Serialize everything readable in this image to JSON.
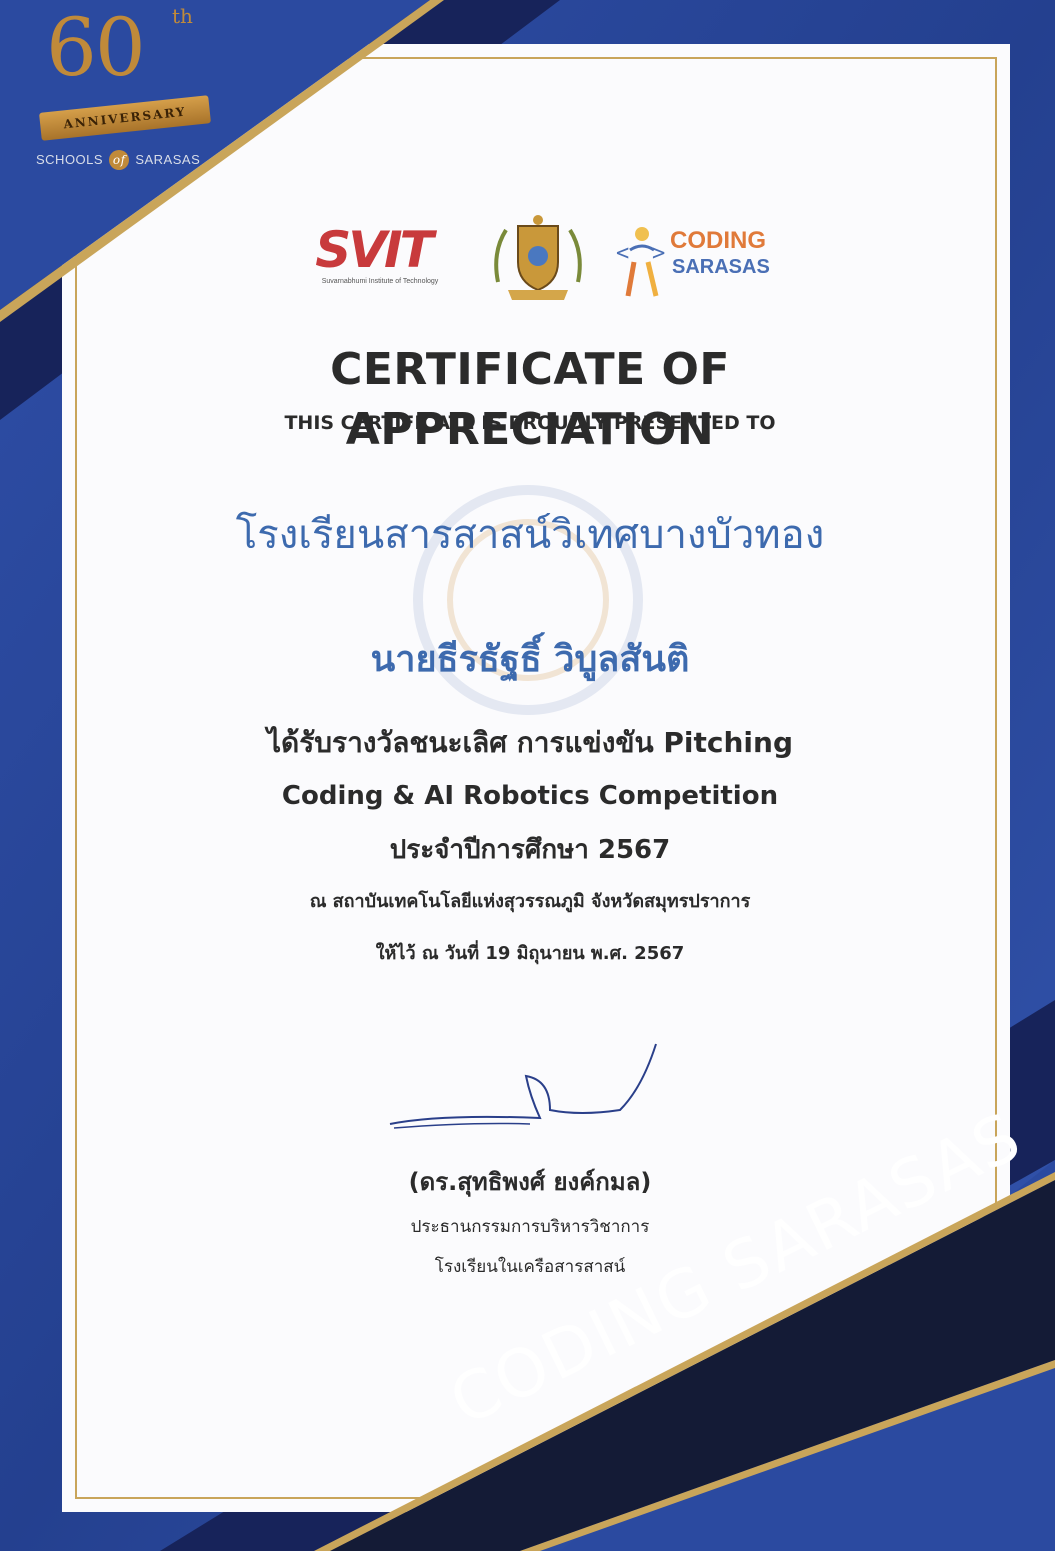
{
  "colors": {
    "frame_navy": "#1a2a6e",
    "frame_blue": "#2f4fa8",
    "gold": "#c08a3a",
    "paper": "#fbfbfd",
    "accent_blue_text": "#3d6aae",
    "body_text": "#2b2b2b",
    "ribbon_dark": "#141b36"
  },
  "anniversary_badge": {
    "number": "60",
    "ordinal": "th",
    "ribbon_text": "ANNIVERSARY",
    "schools_text_left": "SCHOOLS",
    "schools_text_of": "of",
    "schools_text_right": "SARASAS"
  },
  "logos": {
    "svit_mark": "SVIT",
    "svit_subtitle": "Suvarnabhumi Institute of Technology",
    "crest_icon": "school-crest-icon",
    "coding_word": "CODING",
    "sarasas_word": "SARASAS"
  },
  "certificate": {
    "title": "CERTIFICATE OF APPRECIATION",
    "subtitle": "THIS CERTIFICATE IS PROUDLY PRESENTED TO",
    "school": "โรงเรียนสารสาสน์วิเทศบางบัวทอง",
    "student": "นายธีรธัฐธิ์ วิบูลสันติ",
    "award": "ได้รับรางวัลชนะเลิศ การแข่งขัน Pitching",
    "competition": "Coding & AI Robotics Competition",
    "academic_year": "ประจำปีการศึกษา 2567",
    "venue": "ณ  สถาบันเทคโนโลยีแห่งสุวรรณภูมิ  จังหวัดสมุทรปราการ",
    "given_date": "ให้ไว้ ณ วันที่ 19 มิถุนายน พ.ศ. 2567"
  },
  "signatory": {
    "name": "(ดร.สุทธิพงศ์ ยงค์กมล)",
    "position_line1": "ประธานกรรมการบริหารวิชาการ",
    "position_line2": "โรงเรียนในเครือสารสาสน์"
  },
  "corner_ribbon_text": "CODING SARASAS"
}
